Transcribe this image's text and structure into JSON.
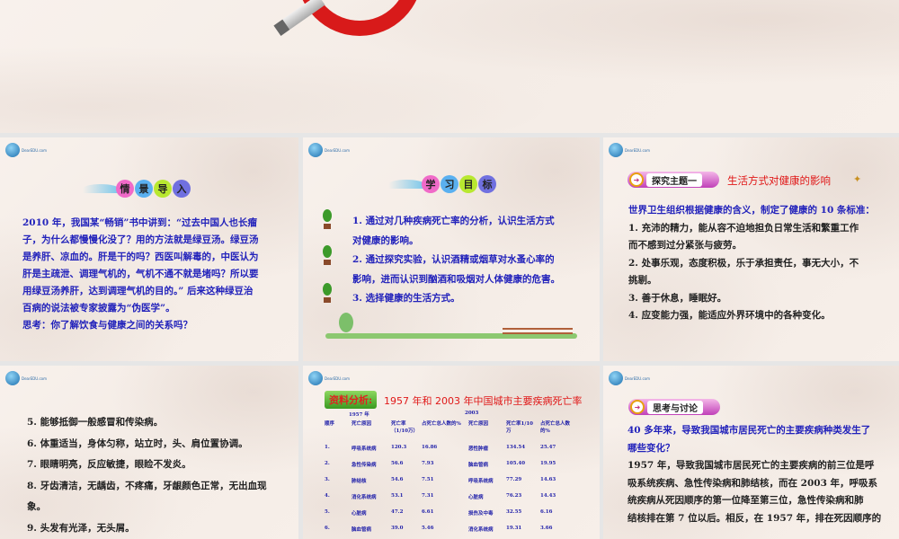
{
  "top_slide": {
    "icon": "no-smoking-icon"
  },
  "slide1": {
    "title_chars": [
      "情",
      "景",
      "导",
      "入"
    ],
    "lines": [
      "2010 年，我国某“畅销”书中讲到：“过去中国人也长瘤",
      "子，为什么都慢慢化没了？用的方法就是绿豆汤。绿豆汤",
      "是养肝、凉血的。肝是干的吗？西医叫解毒的，中医认为",
      "肝是主疏泄、调理气机的，气机不通不就是堵吗？所以要",
      "用绿豆汤养肝，达到调理气机的目的。” 后来这种绿豆治",
      "百病的说法被专家披露为“伪医学”。",
      "思考：你了解饮食与健康之间的关系吗？"
    ]
  },
  "slide2": {
    "title_chars": [
      "学",
      "习",
      "目",
      "标"
    ],
    "lines": [
      "1. 通过对几种疾病死亡率的分析，认识生活方式",
      "对健康的影响。",
      "2. 通过探究实验，认识酒精或烟草对水蚤心率的",
      "影响，进而认识到酗酒和吸烟对人体健康的危害。",
      "3. 选择健康的生活方式。"
    ]
  },
  "slide3": {
    "badge": "探究主题一",
    "heading": "生活方式对健康的影响",
    "intro": "世界卫生组织根据健康的含义，制定了健康的 10 条标准：",
    "lines": [
      "1. 充沛的精力，能从容不迫地担负日常生活和繁重工作",
      "而不感到过分紧张与疲劳。",
      "2. 处事乐观，态度积极，乐于承担责任，事无大小，不",
      "挑剔。",
      "3. 善于休息，睡眠好。",
      "4. 应变能力强，能适应外界环境中的各种变化。"
    ]
  },
  "slide4": {
    "lines": [
      "5. 能够抵御一般感冒和传染病。",
      "6. 体重适当，身体匀称，站立时，头、肩位置协调。",
      "7. 眼睛明亮，反应敏捷，眼睑不发炎。",
      "8. 牙齿清洁，无龋齿，不疼痛，牙龈颜色正常，无出血现",
      "象。",
      "9. 头发有光泽，无头屑。"
    ]
  },
  "slide5": {
    "badge": "资料分析:",
    "title": "1957 年和 2003 年中国城市主要疾病死亡率",
    "year1": "1957 年",
    "year2": "2003",
    "headers": [
      "顺序",
      "死亡原因",
      "死亡率（1/10万）",
      "占死亡总人数的%",
      "死亡原因",
      "死亡率1/10万",
      "占死亡总人数的%"
    ],
    "rows": [
      [
        "1.",
        "呼吸系统病",
        "120.3",
        "16.86",
        "恶性肿瘤",
        "134.54",
        "25.47"
      ],
      [
        "2.",
        "急性传染病",
        "56.6",
        "7.93",
        "脑血管病",
        "105.40",
        "19.95"
      ],
      [
        "3.",
        "肺结核",
        "54.6",
        "7.51",
        "呼吸系统病",
        "77.29",
        "14.63"
      ],
      [
        "4.",
        "消化系统病",
        "53.1",
        "7.31",
        "心脏病",
        "76.23",
        "14.43"
      ],
      [
        "5.",
        "心脏病",
        "47.2",
        "6.61",
        "损伤及中毒",
        "32.55",
        "6.16"
      ],
      [
        "6.",
        "脑血管病",
        "39.0",
        "5.46",
        "消化系统病",
        "19.31",
        "3.66"
      ]
    ]
  },
  "slide6": {
    "badge": "思考与讨论",
    "question": [
      "40 多年来，导致我国城市居民死亡的主要疾病种类发生了",
      "哪些变化？"
    ],
    "lines": [
      "1957 年，导致我国城市居民死亡的主要疾病的前三位是呼",
      "吸系统疾病、急性传染病和肺结核，而在 2003 年，呼吸系",
      "统疾病从死因顺序的第一位降至第三位，急性传染病和肺",
      "结核排在第 7 位以后。相反，在 1957 年，排在死因顺序的"
    ]
  },
  "logo_text": "DearEDU.com"
}
